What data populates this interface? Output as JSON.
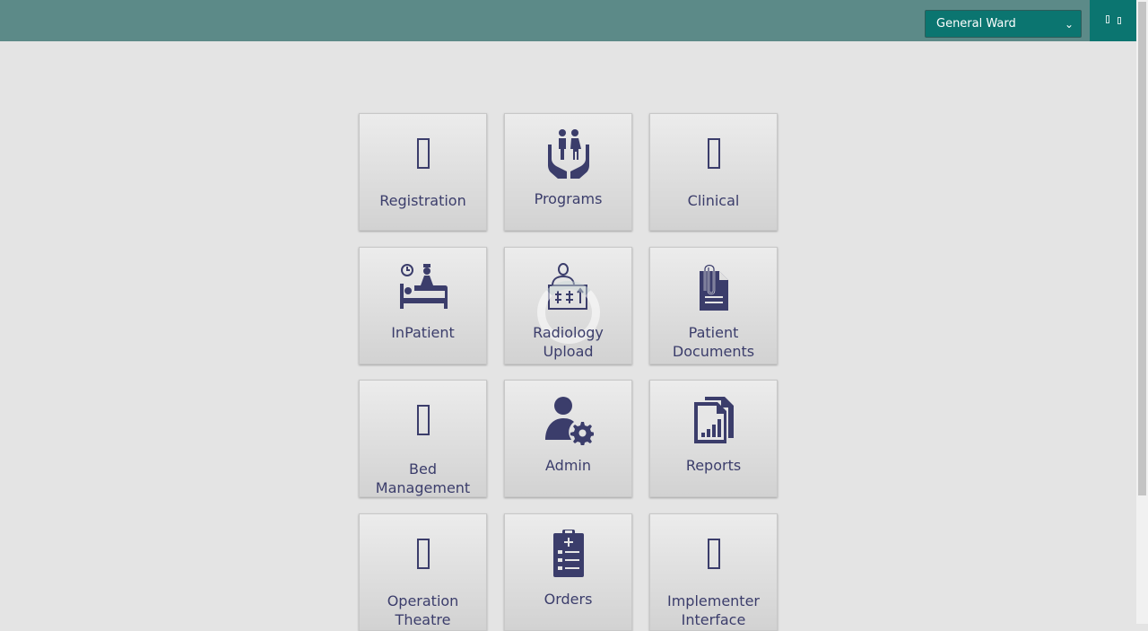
{
  "header": {
    "location_select": {
      "selected": "General Ward"
    }
  },
  "tiles": [
    {
      "label": "Registration",
      "icon": "user-plus-icon"
    },
    {
      "label": "Programs",
      "icon": "family-hands-icon"
    },
    {
      "label": "Clinical",
      "icon": "stethoscope-icon"
    },
    {
      "label": "InPatient",
      "icon": "inpatient-bed-icon"
    },
    {
      "label": "Radiology Upload",
      "icon": "radiology-xray-icon"
    },
    {
      "label": "Patient Documents",
      "icon": "document-clip-icon"
    },
    {
      "label": "Bed Management",
      "icon": "bed-icon"
    },
    {
      "label": "Admin",
      "icon": "user-gear-icon"
    },
    {
      "label": "Reports",
      "icon": "report-chart-icon"
    },
    {
      "label": "Operation Theatre",
      "icon": "operation-theatre-icon"
    },
    {
      "label": "Orders",
      "icon": "clipboard-list-icon"
    },
    {
      "label": "Implementer Interface",
      "icon": "implementer-icon"
    }
  ],
  "colors": {
    "header_bg": "#5c8a88",
    "accent": "#0b7570",
    "tile_text": "#3b3d6b",
    "page_bg": "#e4e4e4"
  }
}
